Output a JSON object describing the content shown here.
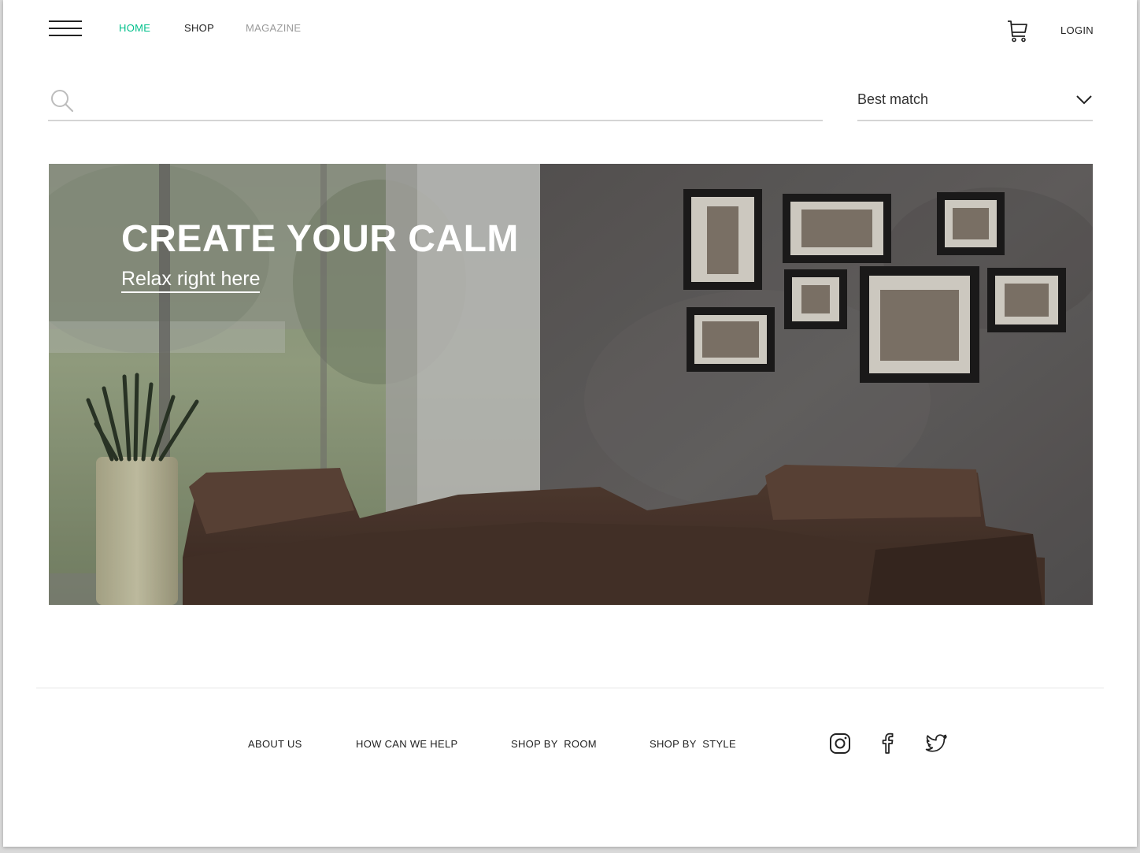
{
  "header": {
    "nav": {
      "home": "HOME",
      "shop": "SHOP",
      "magazine": "MAGAZINE"
    },
    "login": "LOGIN",
    "menu_icon": "hamburger-icon",
    "cart_icon": "cart-icon"
  },
  "search": {
    "placeholder": "",
    "value": "",
    "icon": "search-icon"
  },
  "sort": {
    "selected": "Best match",
    "icon": "chevron-down-icon"
  },
  "hero": {
    "title": "CREATE YOUR CALM",
    "subtitle": "Relax right here"
  },
  "footer": {
    "links": {
      "about": "ABOUT US",
      "help": "HOW CAN WE HELP",
      "room": "SHOP BY  ROOM",
      "style": "SHOP BY  STYLE"
    },
    "social": [
      "instagram-icon",
      "facebook-icon",
      "twitter-icon"
    ]
  },
  "colors": {
    "accent": "#00c08b",
    "muted": "#9a9a9a",
    "text": "#222222"
  }
}
